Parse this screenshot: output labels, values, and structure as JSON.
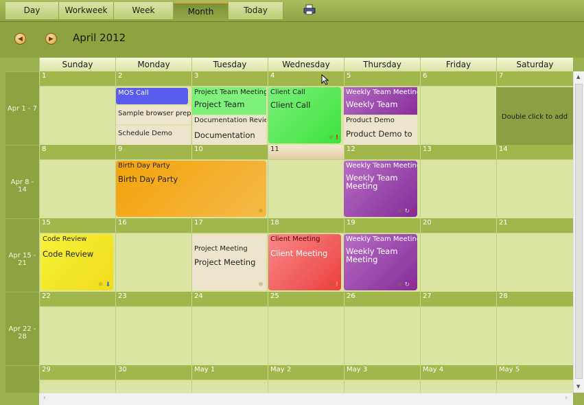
{
  "toolbar": {
    "tabs": [
      "Day",
      "Workweek",
      "Week",
      "Month",
      "Today"
    ],
    "active": "Month",
    "print_icon": "printer-icon"
  },
  "nav": {
    "prev_icon": "arrow-left-icon",
    "next_icon": "arrow-right-icon",
    "title": "April 2012"
  },
  "days": [
    "Sunday",
    "Monday",
    "Tuesday",
    "Wednesday",
    "Thursday",
    "Friday",
    "Saturday"
  ],
  "weeks": [
    {
      "label": "Apr 1 - 7",
      "dates": [
        "1",
        "2",
        "3",
        "4",
        "5",
        "6",
        "7"
      ]
    },
    {
      "label": "Apr 8 - 14",
      "dates": [
        "8",
        "9",
        "10",
        "11",
        "12",
        "13",
        "14"
      ]
    },
    {
      "label": "Apr 15 - 21",
      "dates": [
        "15",
        "16",
        "17",
        "18",
        "19",
        "20",
        "21"
      ]
    },
    {
      "label": "Apr 22 - 28",
      "dates": [
        "22",
        "23",
        "24",
        "25",
        "26",
        "27",
        "28"
      ]
    },
    {
      "label": "",
      "dates": [
        "29",
        "30",
        "May 1",
        "May 2",
        "May 3",
        "May 4",
        "May 5"
      ]
    }
  ],
  "events": {
    "mos_call": "MOS Call",
    "sample_browser": "Sample browser prep",
    "schedule_demo": "Schedule Demo",
    "project_team_meeting": "Project Team Meeting",
    "project_team": "Project Team",
    "documentation_review": "Documentation Revie",
    "documentation": "Documentation",
    "client_call": "Client Call",
    "client_call_big": "Client Call",
    "weekly_team_meeting_1": "Weekly Team Meeting",
    "weekly_team_1": "Weekly Team",
    "product_demo": "Product Demo",
    "product_demo_to": "Product Demo to",
    "double_click": "Double click to add",
    "birthday": "Birth Day Party",
    "birthday_big": "Birth Day Party",
    "weekly_team_meeting_2": "Weekly Team Meeting",
    "weekly_team_2": "Weekly Team Meeting",
    "code_review": "Code Review",
    "code_review_big": "Code Review",
    "project_meeting": "Project Meeting",
    "project_meeting_big": "Project Meeting",
    "client_meeting": "Client Meeting",
    "client_meeting_big": "Client Meeting",
    "weekly_team_meeting_3": "Weekly Team Meeting",
    "weekly_team_3": "Weekly Team Meeting"
  }
}
